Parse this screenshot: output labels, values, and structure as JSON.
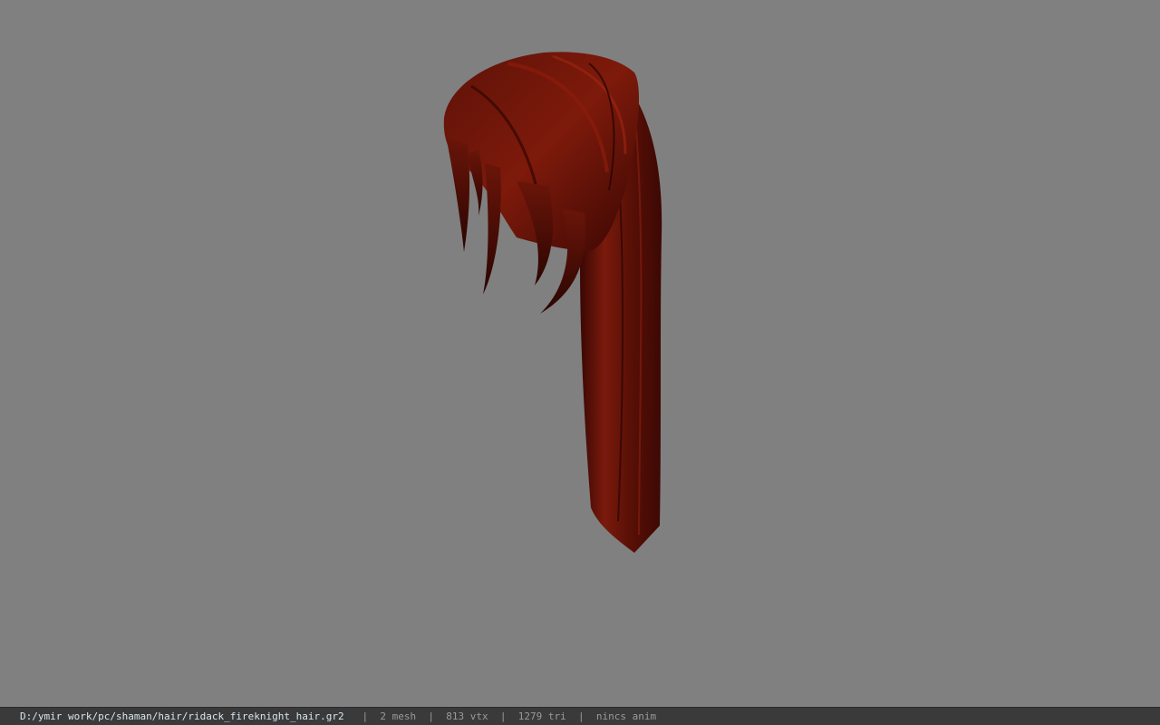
{
  "viewer": {
    "background_color": "#808080",
    "model_icon": "hair-mesh-model",
    "model_color": "#6b1509"
  },
  "statusbar": {
    "file_path": "D:/ymir work/pc/shaman/hair/ridack_fireknight_hair.gr2",
    "separator": "|",
    "mesh_count": "2 mesh",
    "vertex_count": "813 vtx",
    "triangle_count": "1279 tri",
    "animation": "nincs anim"
  }
}
